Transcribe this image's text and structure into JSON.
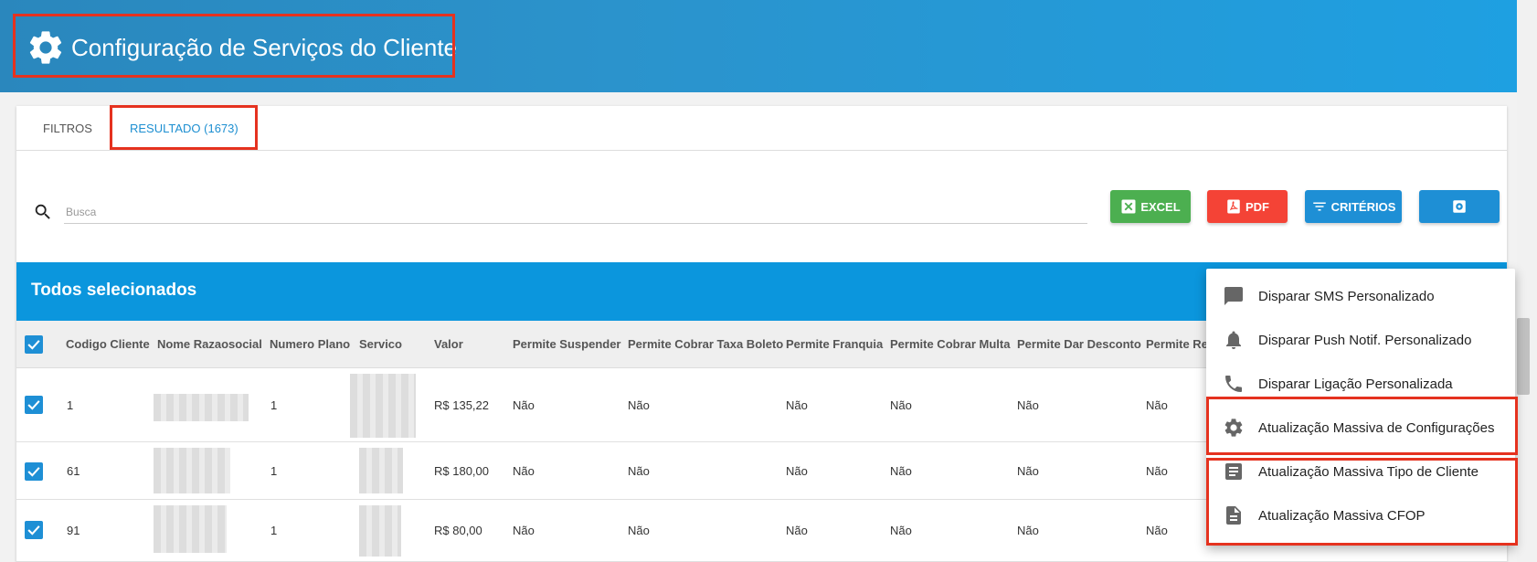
{
  "header": {
    "title": "Configuração de Serviços do Cliente",
    "icon": "gear-icon"
  },
  "tabs": [
    {
      "label": "FILTROS",
      "active": false
    },
    {
      "label": "RESULTADO (1673)",
      "active": true
    }
  ],
  "search": {
    "placeholder": "Busca",
    "value": ""
  },
  "toolbar": {
    "excel_label": "EXCEL",
    "pdf_label": "PDF",
    "criterios_label": "CRITÉRIOS",
    "settings_icon": "settings-icon"
  },
  "colors": {
    "header": "#2b93cc",
    "excel": "#4caf50",
    "pdf": "#f44336",
    "primary": "#1e8fd5",
    "highlight": "#e5321f"
  },
  "selection_bar": {
    "label": "Todos selecionados"
  },
  "table": {
    "columns": [
      "Codigo Cliente",
      "Nome Razaosocial",
      "Numero Plano",
      "Servico",
      "Valor",
      "Permite Suspender",
      "Permite Cobrar Taxa Boleto",
      "Permite Franquia",
      "Permite Cobrar Multa",
      "Permite Dar Desconto",
      "Permite Re"
    ],
    "rows": [
      {
        "codigo": "1",
        "plano": "1",
        "valor": "R$ 135,22",
        "suspender": "Não",
        "taxa": "Não",
        "franquia": "Não",
        "multa": "Não",
        "desconto": "Não",
        "re": "Não"
      },
      {
        "codigo": "61",
        "plano": "1",
        "valor": "R$ 180,00",
        "suspender": "Não",
        "taxa": "Não",
        "franquia": "Não",
        "multa": "Não",
        "desconto": "Não",
        "re": "Não"
      },
      {
        "codigo": "91",
        "plano": "1",
        "valor": "R$ 80,00",
        "suspender": "Não",
        "taxa": "Não",
        "franquia": "Não",
        "multa": "Não",
        "desconto": "Não",
        "re": "Não"
      }
    ]
  },
  "menu": {
    "items": [
      {
        "label": "Disparar SMS Personalizado",
        "icon": "chat-icon"
      },
      {
        "label": "Disparar Push Notif. Personalizado",
        "icon": "bell-icon"
      },
      {
        "label": "Disparar Ligação Personalizada",
        "icon": "phone-icon"
      },
      {
        "label": "Atualização Massiva de Configurações",
        "icon": "gear-icon"
      },
      {
        "label": "Atualização Massiva Tipo de Cliente",
        "icon": "list-icon"
      },
      {
        "label": "Atualização Massiva CFOP",
        "icon": "document-icon"
      }
    ]
  }
}
